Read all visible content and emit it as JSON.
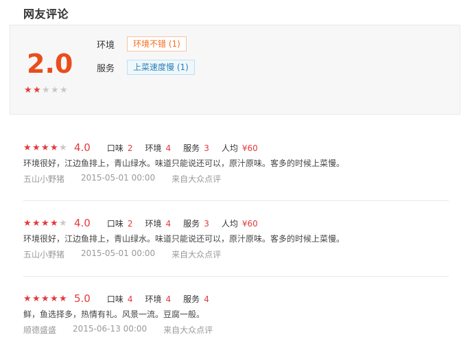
{
  "section_title": "网友评论",
  "summary": {
    "score": "2.0",
    "stars_on": 2,
    "stars_total": 5,
    "tags": [
      {
        "label": "环境",
        "value": "环境不错 (1)",
        "color": "orange"
      },
      {
        "label": "服务",
        "value": "上菜速度慢 (1)",
        "color": "blue"
      }
    ]
  },
  "reviews": [
    {
      "stars_on": 4,
      "rating": "4.0",
      "taste_label": "口味",
      "taste": "2",
      "env_label": "环境",
      "env": "4",
      "service_label": "服务",
      "service": "3",
      "price_label": "人均",
      "price": "¥60",
      "text": "环境很好，江边鱼排上，青山绿水。味道只能说还可以，原汁原味。客多的时候上菜慢。",
      "user": "五山小野猪",
      "date": "2015-05-01 00:00",
      "source": "来自大众点评"
    },
    {
      "stars_on": 4,
      "rating": "4.0",
      "taste_label": "口味",
      "taste": "2",
      "env_label": "环境",
      "env": "4",
      "service_label": "服务",
      "service": "3",
      "price_label": "人均",
      "price": "¥60",
      "text": "环境很好，江边鱼排上，青山绿水。味道只能说还可以，原汁原味。客多的时候上菜慢。",
      "user": "五山小野猪",
      "date": "2015-05-01 00:00",
      "source": "来自大众点评"
    },
    {
      "stars_on": 5,
      "rating": "5.0",
      "taste_label": "口味",
      "taste": "4",
      "env_label": "环境",
      "env": "4",
      "service_label": "服务",
      "service": "4",
      "price_label": "",
      "price": "",
      "text": "鲜，鱼选择多，热情有礼。风景一流。豆腐一般。",
      "user": "顺德盛盛",
      "date": "2015-06-13 00:00",
      "source": "来自大众点评"
    }
  ],
  "colors": {
    "accent": "#e4393c",
    "score": "#e94e1b"
  },
  "icons": {
    "star": "star-icon"
  }
}
